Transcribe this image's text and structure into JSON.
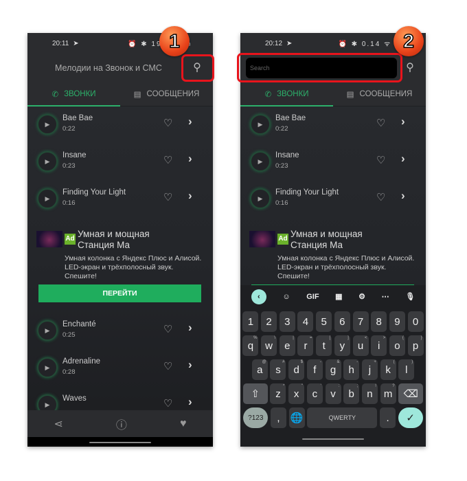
{
  "screens": [
    {
      "status": {
        "time": "20:11",
        "right": "⏰ ✱ 19.0 ᯤ ▭"
      },
      "header": {
        "title": "Мелодии на Звонок и СМС"
      },
      "badge": "1"
    },
    {
      "status": {
        "time": "20:12",
        "right": "⏰ ✱ 0.14 ᯤ ▮▮"
      },
      "header": {
        "search_placeholder": "Search"
      },
      "badge": "2"
    }
  ],
  "tabs": [
    {
      "label": "ЗВОНКИ",
      "icon": "phone-icon",
      "active": true
    },
    {
      "label": "СООБЩЕНИЯ",
      "icon": "message-icon",
      "active": false
    }
  ],
  "songs": [
    {
      "name": "Bae Bae",
      "duration": "0:22"
    },
    {
      "name": "Insane",
      "duration": "0:23"
    },
    {
      "name": "Finding Your Light",
      "duration": "0:16"
    },
    {
      "name": "Enchanté",
      "duration": "0:25"
    },
    {
      "name": "Adrenaline",
      "duration": "0:28"
    },
    {
      "name": "Waves",
      "duration": ""
    }
  ],
  "ad": {
    "badge": "Ad",
    "title_line1": "Умная и мощная",
    "title_line2": "Станция Ма",
    "desc_line1": "Умная колонка с Яндекс Плюс и Алисой.",
    "desc_line2": "LED-экран и трёхполосный звук.",
    "desc_line3": "Спешите!",
    "button": "ПЕРЕЙТИ"
  },
  "bottom_nav": [
    "share-icon",
    "info-icon",
    "heart-icon"
  ],
  "keyboard": {
    "toolbar": {
      "gif": "GIF"
    },
    "rows": [
      [
        "1",
        "2",
        "3",
        "4",
        "5",
        "6",
        "7",
        "8",
        "9",
        "0"
      ],
      [
        "q",
        "w",
        "e",
        "r",
        "t",
        "y",
        "u",
        "i",
        "o",
        "p"
      ],
      [
        "a",
        "s",
        "d",
        "f",
        "g",
        "h",
        "j",
        "k",
        "l"
      ],
      [
        "z",
        "x",
        "c",
        "v",
        "b",
        "n",
        "m"
      ]
    ],
    "hints": [
      [
        "%",
        "\\",
        "|",
        "=",
        "[",
        "]",
        "<",
        ">",
        "{",
        "}"
      ],
      [
        "@",
        "#",
        "$",
        "-",
        "&",
        "-",
        "+",
        "(",
        ")"
      ],
      [
        "*",
        "\"",
        "'",
        ":",
        ";",
        "!",
        "?"
      ]
    ],
    "symbols_key": "?123",
    "comma": ",",
    "space": "QWERTY",
    "period": "."
  },
  "colors": {
    "accent": "#2cb06a",
    "highlight": "#e8141c",
    "key_accent": "#9ee7db"
  }
}
